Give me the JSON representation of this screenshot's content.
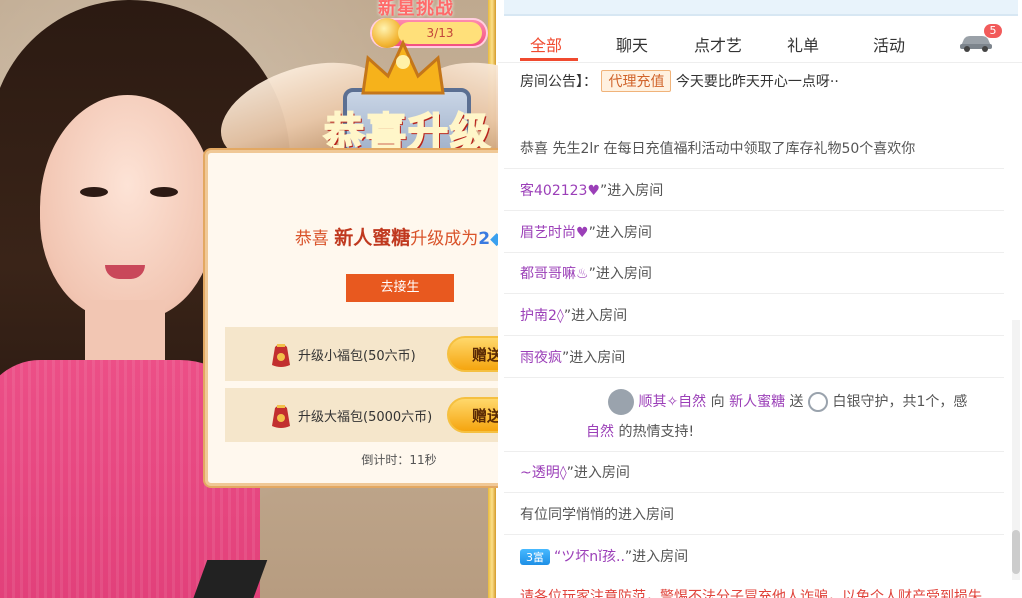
{
  "challenge": {
    "title": "新星挑战",
    "count": "3/13"
  },
  "levelup": {
    "emblem_title": "恭喜升级",
    "msg_prefix": "恭喜",
    "user": "新人蜜糖",
    "msg_middle": "升级成为",
    "level": "2",
    "goto_label": "去接生",
    "packs": [
      {
        "label": "升级小福包(50六币)",
        "send": "赠送"
      },
      {
        "label": "升级大福包(5000六币)",
        "send": "赠送"
      }
    ],
    "countdown": "倒计时：11秒",
    "close": "×"
  },
  "chat": {
    "tabs": [
      "全部",
      "聊天",
      "点才艺",
      "礼单",
      "活动"
    ],
    "active_tab": "全部",
    "car_badge": "5",
    "notice_head": "房间公告】：",
    "notice_pill": "代理充值",
    "notice_text": "今天要比昨天开心一点呀··",
    "lines": [
      {
        "text": "恭喜 先生2lr 在每日充值福利活动中领取了库存礼物50个喜欢你"
      },
      {
        "user": "客402123♥",
        "suffix": "”进入房间"
      },
      {
        "user": "眉艺时尚♥",
        "suffix": "”进入房间"
      },
      {
        "user": "都哥哥嘛♨",
        "suffix": "”进入房间"
      },
      {
        "user": "护南2◊",
        "suffix": "”进入房间"
      },
      {
        "user": "雨夜疯",
        "suffix": "”进入房间"
      },
      {
        "gift_from": "顺其✧自然",
        "gift_verb": "向",
        "gift_to": "新人蜜糖",
        "gift_send": "送",
        "gift_name": "白银守护，共1个，感",
        "gift_line2_user": "自然",
        "gift_line2": "的热情支持!"
      },
      {
        "user": "~透明◊",
        "suffix": "”进入房间"
      },
      {
        "plain": "有位同学悄悄的进入房间"
      },
      {
        "vip": "3富",
        "user": "“ツ坏nǐ孩..",
        "suffix": "”进入房间"
      }
    ],
    "footer_warning": "请各位玩家注意防范，警惕不法分子冒充他人诈骗，以免个人财产受到损失"
  }
}
